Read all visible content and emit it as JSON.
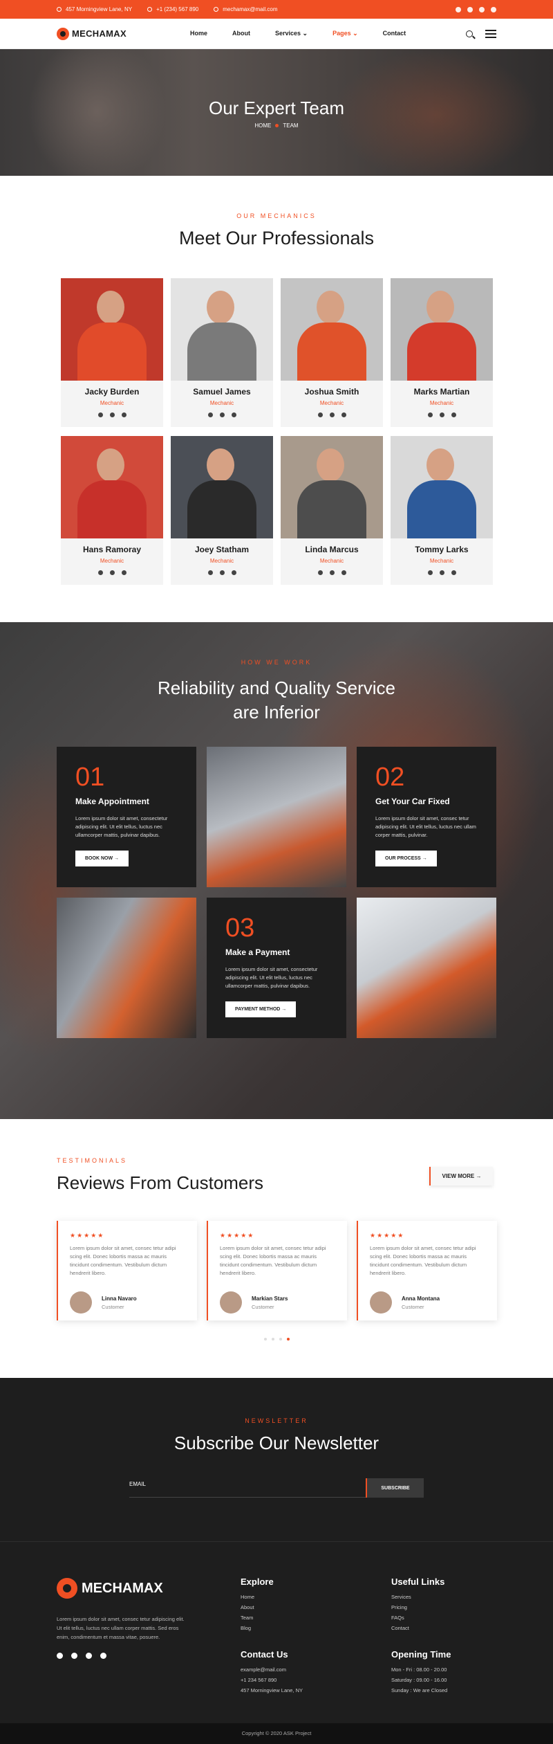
{
  "topbar": {
    "address": "457 Morningview Lane, NY",
    "phone": "+1 (234) 567 890",
    "email": "mechamax@mail.com",
    "social_icons": [
      "facebook-icon",
      "twitter-icon",
      "youtube-icon",
      "instagram-icon"
    ]
  },
  "nav": {
    "logo": "MECHAMAX",
    "items": [
      "Home",
      "About",
      "Services",
      "Pages",
      "Contact"
    ],
    "active": "Pages"
  },
  "hero": {
    "title": "Our Expert Team",
    "crumb_home": "HOME",
    "crumb_current": "TEAM"
  },
  "team": {
    "subtitle": "OUR MECHANICS",
    "title": "Meet Our Professionals",
    "members": [
      {
        "name": "Jacky Burden",
        "role": "Mechanic"
      },
      {
        "name": "Samuel James",
        "role": "Mechanic"
      },
      {
        "name": "Joshua Smith",
        "role": "Mechanic"
      },
      {
        "name": "Marks Martian",
        "role": "Mechanic"
      },
      {
        "name": "Hans Ramoray",
        "role": "Mechanic"
      },
      {
        "name": "Joey Statham",
        "role": "Mechanic"
      },
      {
        "name": "Linda Marcus",
        "role": "Mechanic"
      },
      {
        "name": "Tommy Larks",
        "role": "Mechanic"
      }
    ]
  },
  "work": {
    "subtitle": "HOW WE WORK",
    "title_line1": "Reliability and Quality Service",
    "title_line2": "are Inferior",
    "steps": [
      {
        "num": "01",
        "title": "Make Appointment",
        "desc": "Lorem ipsum dolor sit amet, consectetur adipiscing elit. Ut elit tellus, luctus nec ullamcorper mattis, pulvinar dapibus.",
        "button": "BOOK NOW"
      },
      {
        "num": "02",
        "title": "Get Your Car Fixed",
        "desc": "Lorem ipsum dolor sit amet, consec tetur adipiscing elit. Ut elit tellus, luctus nec ullam corper mattis, pulvinar.",
        "button": "OUR PROCESS"
      },
      {
        "num": "03",
        "title": "Make a Payment",
        "desc": "Lorem ipsum dolor sit amet, consectetur adipiscing elit. Ut elit tellus, luctus nec ullamcorper mattis, pulvinar dapibus.",
        "button": "PAYMENT METHOD"
      }
    ]
  },
  "reviews": {
    "subtitle": "TESTIMONIALS",
    "title": "Reviews From Customers",
    "view_more": "VIEW MORE",
    "items": [
      {
        "stars": "★★★★★",
        "text": "Lorem ipsum dolor sit amet, consec tetur adipi scing elit. Donec lobortis massa ac mauris tincidunt condimentum. Vestibulum dictum hendrerit libero.",
        "name": "Linna Navaro",
        "role": "Customer"
      },
      {
        "stars": "★★★★★",
        "text": "Lorem ipsum dolor sit amet, consec tetur adipi scing elit. Donec lobortis massa ac mauris tincidunt condimentum. Vestibulum dictum hendrerit libero.",
        "name": "Markian Stars",
        "role": "Customer"
      },
      {
        "stars": "★★★★★",
        "text": "Lorem ipsum dolor sit amet, consec tetur adipi scing elit. Donec lobortis massa ac mauris tincidunt condimentum. Vestibulum dictum hendrerit libero.",
        "name": "Anna Montana",
        "role": "Customer"
      }
    ]
  },
  "newsletter": {
    "subtitle": "NEWSLETTER",
    "title": "Subscribe Our Newsletter",
    "placeholder": "EMAIL",
    "button": "SUBSCRIBE"
  },
  "footer": {
    "logo": "MECHAMAX",
    "desc": "Lorem ipsum dolor sit amet, consec tetur adipiscing elit. Ut elit tellus, luctus nec ullam corper mattis. Sed eros enim, condimentum et massa vitae, posuere.",
    "explore_title": "Explore",
    "explore": [
      "Home",
      "About",
      "Team",
      "Blog"
    ],
    "links_title": "Useful Links",
    "links": [
      "Services",
      "Pricing",
      "FAQs",
      "Contact"
    ],
    "contact_title": "Contact Us",
    "contact": [
      "example@mail.com",
      "+1 234 567 890",
      "457 Morningview Lane, NY"
    ],
    "hours_title": "Opening Time",
    "hours": [
      "Mon - Fri : 08.00 - 20.00",
      "Saturday : 09.00 - 16.00",
      "Sunday : We are Closed"
    ],
    "copyright": "Copyright © 2020 ASK Project"
  },
  "colors": {
    "accent": "#f04f23",
    "dark": "#1e1e1e"
  }
}
